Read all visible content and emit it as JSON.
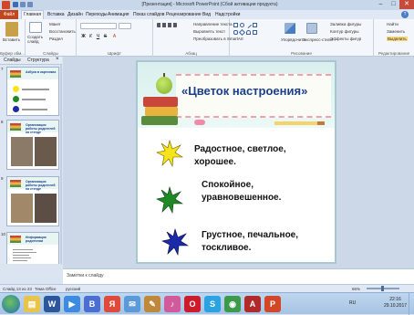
{
  "window": {
    "title": "[Презентация] - Microsoft PowerPoint (Сбой активации продукта)",
    "minimize": "–",
    "maximize": "□",
    "close": "✕"
  },
  "ribbon_tabs": {
    "file": "Файл",
    "items": [
      "Главная",
      "Вставка",
      "Дизайн",
      "Переходы",
      "Анимация",
      "Показ слайдов",
      "Рецензирование",
      "Вид",
      "Надстройки"
    ]
  },
  "ribbon": {
    "clipboard": {
      "paste": "Вставить",
      "label": "Буфер обм..."
    },
    "slides": {
      "new_slide": "Создать слайд",
      "layout": "Макет",
      "reset": "Восстановить",
      "section": "Раздел",
      "label": "Слайды"
    },
    "font": {
      "label": "Шрифт"
    },
    "paragraph": {
      "direction": "Направление текста",
      "align": "Выровнять текст",
      "smartart": "Преобразовать в SmartArt",
      "label": "Абзац"
    },
    "drawing": {
      "arrange": "Упорядочить",
      "quick_styles": "Экспресс-стили",
      "fill": "Заливка фигуры",
      "outline": "Контур фигуры",
      "effects": "Эффекты фигур",
      "label": "Рисование"
    },
    "editing": {
      "find": "Найти",
      "replace": "Заменить",
      "select": "Выделить",
      "label": "Редактирование"
    }
  },
  "left_panel": {
    "tab_slides": "Слайды",
    "tab_outline": "Структура",
    "close": "×"
  },
  "thumbnails": [
    {
      "num": "7",
      "title": "Азбука в картинках"
    },
    {
      "num": "8",
      "title": "Организация работы родителей на стенде"
    },
    {
      "num": "9",
      "title": "Организация работы родителей на стенде"
    },
    {
      "num": "10",
      "title": "Информация родителям"
    }
  ],
  "slide": {
    "title": "«Цветок настроения»",
    "moods": [
      {
        "color": "#f5e41c",
        "line1": "Радостное, светлое,",
        "line2": "хорошее."
      },
      {
        "color": "#1f8a24",
        "line1": "Спокойное,",
        "line2": "уравновешенное."
      },
      {
        "color": "#1a2aa8",
        "line1": "Грустное, печальное,",
        "line2": "тоскливое."
      }
    ]
  },
  "notes": {
    "placeholder": "Заметки к слайду"
  },
  "status": {
    "slide_info": "Слайд 13 из 23",
    "theme": "Тема Office",
    "language": "русский",
    "zoom": "66%"
  },
  "taskbar": {
    "apps": [
      {
        "icon": "explorer-icon",
        "color": "#e8c44a",
        "glyph": "▤"
      },
      {
        "icon": "word-icon",
        "color": "#2b579a",
        "glyph": "W"
      },
      {
        "icon": "media-icon",
        "color": "#3d8be0",
        "glyph": "▶"
      },
      {
        "icon": "browser-b-icon",
        "color": "#4a6fd0",
        "glyph": "B"
      },
      {
        "icon": "yandex-icon",
        "color": "#e04a3a",
        "glyph": "Я"
      },
      {
        "icon": "mail-icon",
        "color": "#5a9ad8",
        "glyph": "✉"
      },
      {
        "icon": "paint-icon",
        "color": "#c0883a",
        "glyph": "✎"
      },
      {
        "icon": "music-icon",
        "color": "#d05a9a",
        "glyph": "♪"
      },
      {
        "icon": "opera-icon",
        "color": "#cc1b2b",
        "glyph": "O"
      },
      {
        "icon": "skype-icon",
        "color": "#2aa3e0",
        "glyph": "S"
      },
      {
        "icon": "chrome-icon",
        "color": "#3c9a4a",
        "glyph": "◉"
      },
      {
        "icon": "pdf-icon",
        "color": "#b02a2a",
        "glyph": "A"
      },
      {
        "icon": "powerpoint-icon",
        "color": "#d24726",
        "glyph": "P"
      }
    ],
    "language": "RU",
    "time": "22:16",
    "date": "29.10.2017"
  }
}
